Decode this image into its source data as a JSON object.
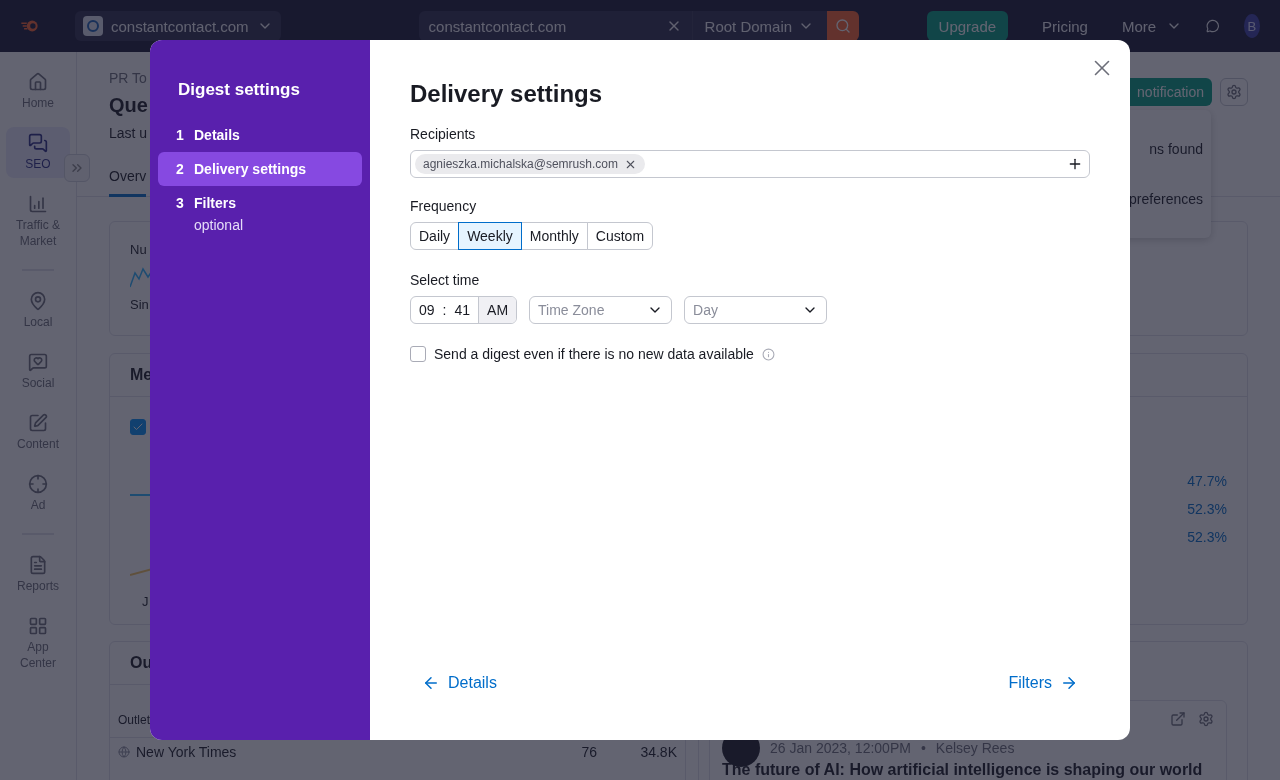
{
  "topbar": {
    "project": "constantcontact.com",
    "search": {
      "value": "constantcontact.com"
    },
    "scope": "Root Domain",
    "upgrade": "Upgrade",
    "pricing": "Pricing",
    "more": "More",
    "avatar": "B"
  },
  "sidebar": {
    "items": [
      {
        "label": "Home",
        "selected": false
      },
      {
        "label": "SEO",
        "selected": true
      },
      {
        "label": "Traffic & Market",
        "selected": false
      },
      {
        "label": "Local",
        "selected": false
      },
      {
        "label": "Social",
        "selected": false
      },
      {
        "label": "Content",
        "selected": false
      },
      {
        "label": "Ad",
        "selected": false
      },
      {
        "label": "Reports",
        "selected": false
      },
      {
        "label": "App Center",
        "selected": false
      }
    ]
  },
  "page": {
    "breadcrumb": "PR To",
    "title": "Que",
    "updated": "Last u",
    "tab": "Overv",
    "notify_button": "notification",
    "menu": [
      "ns found",
      "preferences"
    ],
    "card1": {
      "title": "Nu",
      "note": "Sin"
    },
    "card2": {
      "title": "Me",
      "checked": true,
      "axis": "J",
      "percents": [
        "47.7%",
        "52.3%",
        "52.3%"
      ]
    },
    "card3": {
      "title": "Ou",
      "column": "Outlet",
      "rows": [
        {
          "name": "New York Times",
          "mentions": "76",
          "reach": "34.8K"
        }
      ]
    },
    "article": {
      "date": "26 Jan 2023, 12:00PM",
      "separator": "•",
      "author": "Kelsey Rees",
      "title": "The future of AI: How artificial intelligence is shaping our world"
    }
  },
  "modal": {
    "sidebar_title": "Digest settings",
    "steps": [
      {
        "number": "1",
        "label": "Details",
        "selected": false
      },
      {
        "number": "2",
        "label": "Delivery settings",
        "selected": true
      },
      {
        "number": "3",
        "label": "Filters",
        "note": "optional",
        "selected": false
      }
    ],
    "title": "Delivery settings",
    "recipients": {
      "label": "Recipients",
      "chips": [
        "agnieszka.michalska@semrush.com"
      ]
    },
    "frequency": {
      "label": "Frequency",
      "options": [
        {
          "label": "Daily",
          "selected": false
        },
        {
          "label": "Weekly",
          "selected": true
        },
        {
          "label": "Monthly",
          "selected": false
        },
        {
          "label": "Custom",
          "selected": false
        }
      ]
    },
    "time": {
      "label": "Select time",
      "hour": "09",
      "separator": ":",
      "minute": "41",
      "period": "AM",
      "timezone_placeholder": "Time Zone",
      "day_placeholder": "Day"
    },
    "no_data": {
      "label": "Send a digest even if there is no new data available",
      "checked": false
    },
    "back": "Details",
    "next": "Filters"
  }
}
